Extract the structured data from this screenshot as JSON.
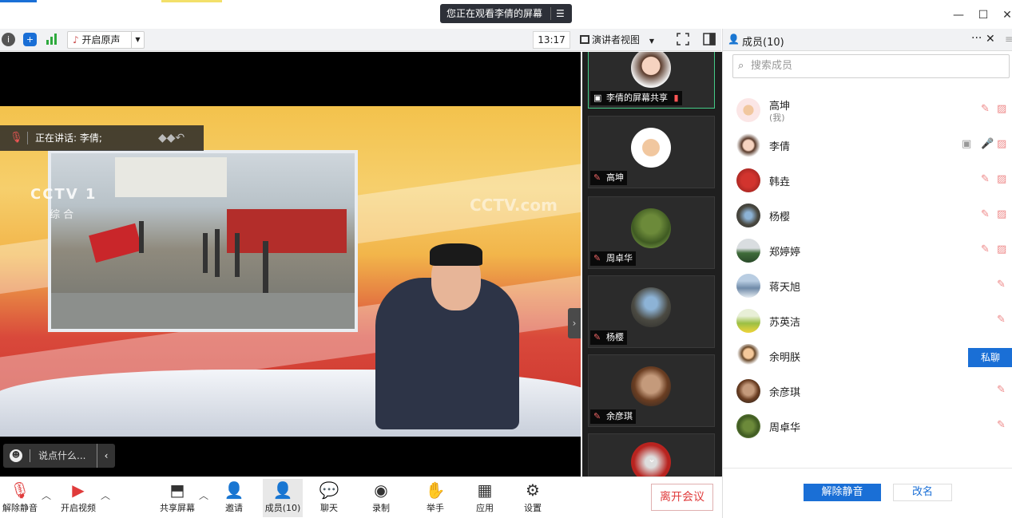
{
  "title_bar": {
    "viewing_text": "您正在观看李倩的屏幕",
    "menu_icon": "list-icon",
    "minimize_icon": "minimize-icon",
    "maximize_icon": "maximize-icon",
    "close_icon": "close-icon"
  },
  "toolbar": {
    "info_icon": "info-icon",
    "shield_icon": "shield-icon",
    "signal_icon": "signal-icon",
    "original_audio_label": "开启原声",
    "clock": "13:17",
    "view_mode_label": "演讲者视图",
    "fullscreen_icon": "fullscreen-icon",
    "panel_toggle_icon": "sidebar-toggle-icon"
  },
  "stage": {
    "speaking_label": "正在讲话: 李倩;",
    "chat_placeholder": "说点什么...",
    "broadcast_logo": "CCTV 1",
    "broadcast_sub": "综 合",
    "broadcast_watermark": "CCTV.com"
  },
  "thumbnails": [
    {
      "name": "李倩的屏幕共享",
      "status": "screen-share"
    },
    {
      "name": "高坤",
      "status": "muted"
    },
    {
      "name": "周卓华",
      "status": "muted"
    },
    {
      "name": "杨樱",
      "status": "muted"
    },
    {
      "name": "余彦琪",
      "status": "muted"
    }
  ],
  "bottom_bar": {
    "unmute": "解除静音",
    "start_video": "开启视频",
    "share_screen": "共享屏幕",
    "invite": "邀请",
    "members": "成员(10)",
    "chat": "聊天",
    "record": "录制",
    "raise_hand": "举手",
    "apps": "应用",
    "settings": "设置",
    "leave": "离开会议"
  },
  "panel": {
    "title": "成员(10)",
    "more": "···",
    "close": "✕",
    "search_placeholder": "搜索成员",
    "members": [
      {
        "name": "高坤",
        "sub": "(我)"
      },
      {
        "name": "李倩",
        "sub": ""
      },
      {
        "name": "韩垚",
        "sub": ""
      },
      {
        "name": "杨樱",
        "sub": ""
      },
      {
        "name": "郑婷婷",
        "sub": ""
      },
      {
        "name": "蒋天旭",
        "sub": ""
      },
      {
        "name": "苏英洁",
        "sub": ""
      },
      {
        "name": "余明朕",
        "sub": ""
      },
      {
        "name": "余彦琪",
        "sub": ""
      },
      {
        "name": "周卓华",
        "sub": ""
      }
    ],
    "private_chat": "私聊",
    "unmute_all": "解除静音",
    "rename": "改名"
  },
  "colors": {
    "accent": "#1a6fd6",
    "danger": "#e03b3b",
    "stage_bg": "#000000"
  }
}
